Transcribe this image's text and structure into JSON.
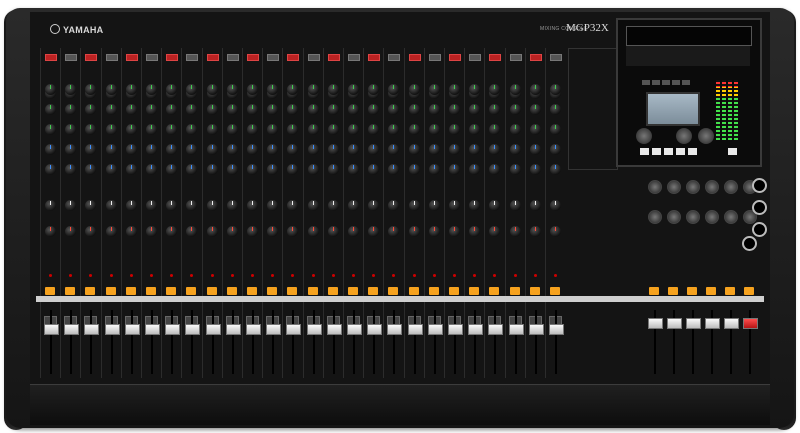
{
  "brand": {
    "name": "YAMAHA",
    "logo_icon": "tuning-fork-logo-icon"
  },
  "model": {
    "label": "MIXING CONSOLE",
    "name": "MGP32X"
  },
  "colors": {
    "body": "#141414",
    "accent_orange": "#f6a21e",
    "rail": "#cfcfcf",
    "fader_red": "#e52a2a"
  },
  "input_channels": 26,
  "group_faders": 6,
  "knob_rows": [
    "green-eq",
    "green-eq",
    "green-eq",
    "blue-aux",
    "blue-aux",
    "white-pan",
    "red-level"
  ]
}
